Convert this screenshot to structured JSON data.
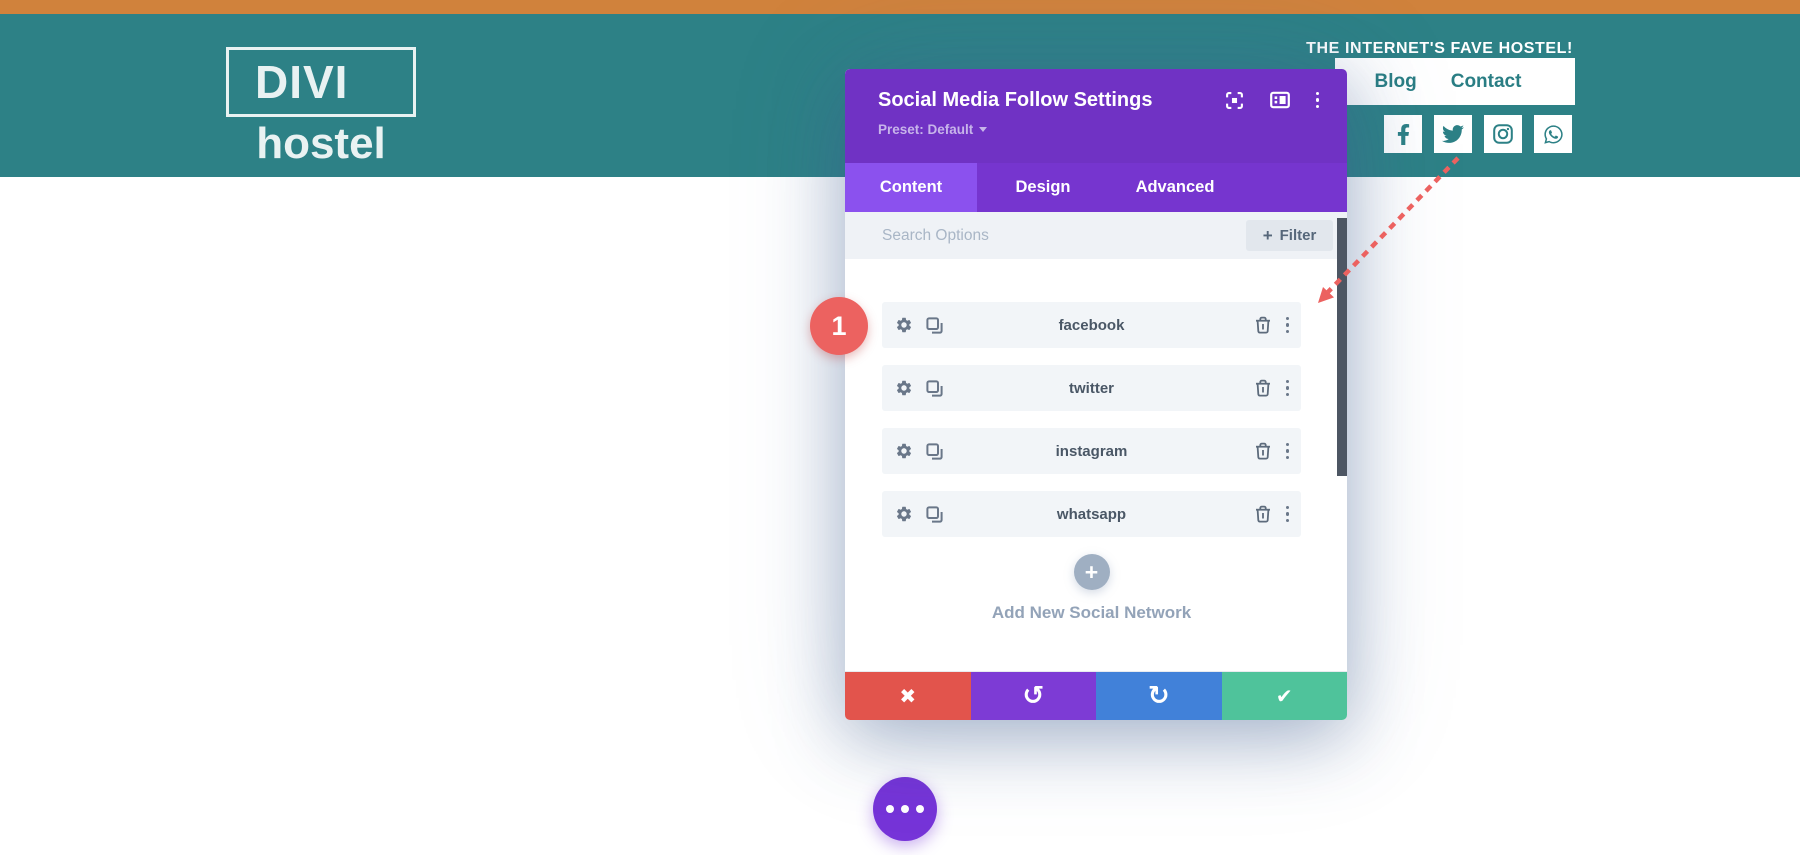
{
  "site": {
    "tagline": "THE INTERNET'S FAVE HOSTEL!",
    "logo_top": "DIVI",
    "logo_bottom": "hostel",
    "nav": {
      "blog": "Blog",
      "contact": "Contact"
    },
    "social_icons": [
      "facebook-icon",
      "twitter-icon",
      "instagram-icon",
      "whatsapp-icon"
    ]
  },
  "modal": {
    "title": "Social Media Follow Settings",
    "preset": "Preset: Default",
    "header_icons": [
      "expand-icon",
      "split-view-icon",
      "kebab-menu-icon"
    ],
    "tabs": [
      {
        "label": "Content",
        "active": true
      },
      {
        "label": "Design",
        "active": false
      },
      {
        "label": "Advanced",
        "active": false
      }
    ],
    "search_placeholder": "Search Options",
    "filter_plus": "+",
    "filter_label": "Filter",
    "row_icons": [
      "gear-icon",
      "duplicate-icon",
      "trash-icon",
      "kebab-menu-icon"
    ],
    "items": [
      {
        "label": "facebook"
      },
      {
        "label": "twitter"
      },
      {
        "label": "instagram"
      },
      {
        "label": "whatsapp"
      }
    ],
    "add_plus": "+",
    "add_new_label": "Add New Social Network",
    "footer_buttons": [
      {
        "name": "discard-button",
        "glyph": "✖",
        "color": "#e2544c"
      },
      {
        "name": "undo-button",
        "glyph": "↺",
        "color": "#7d3bd5"
      },
      {
        "name": "redo-button",
        "glyph": "↻",
        "color": "#4181d9"
      },
      {
        "name": "save-button",
        "glyph": "✔",
        "color": "#4fc39b"
      }
    ]
  },
  "annotation": {
    "step_badge": "1"
  },
  "colors": {
    "orange_bar": "#d0823c",
    "teal": "#2d8186",
    "modal_header_purple": "#7032c4",
    "tabbar_purple": "#7635cf",
    "active_tab_purple": "#8b51ee",
    "annotation_red": "#ec6260",
    "fab_purple": "#7634d8",
    "scrollbar_gray": "#4d5663"
  }
}
